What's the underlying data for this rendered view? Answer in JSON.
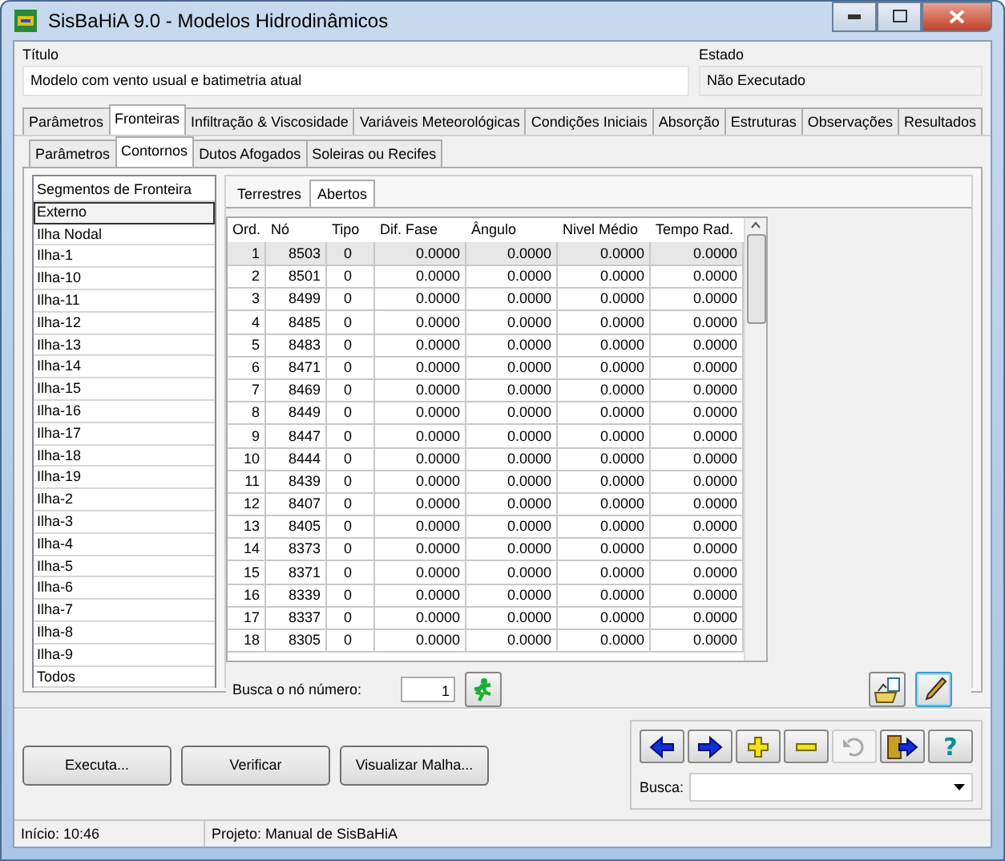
{
  "window": {
    "title": "SisBaHiA 9.0 - Modelos Hidrodinâmicos"
  },
  "titulo": {
    "label": "Título",
    "value": "Modelo com vento usual e batimetria atual"
  },
  "estado": {
    "label": "Estado",
    "value": "Não Executado"
  },
  "tabs": [
    {
      "label": "Parâmetros",
      "selected": false
    },
    {
      "label": "Fronteiras",
      "selected": true
    },
    {
      "label": "Infiltração & Viscosidade",
      "selected": false
    },
    {
      "label": "Variáveis Meteorológicas",
      "selected": false
    },
    {
      "label": "Condições Iniciais",
      "selected": false
    },
    {
      "label": "Absorção",
      "selected": false
    },
    {
      "label": "Estruturas",
      "selected": false
    },
    {
      "label": "Observações",
      "selected": false
    },
    {
      "label": "Resultados",
      "selected": false
    }
  ],
  "subtabs": [
    {
      "label": "Parâmetros",
      "selected": false
    },
    {
      "label": "Contornos",
      "selected": true
    },
    {
      "label": "Dutos Afogados",
      "selected": false
    },
    {
      "label": "Soleiras ou Recifes",
      "selected": false
    }
  ],
  "segments": {
    "header": "Segmentos de Fronteira",
    "items": [
      {
        "label": "Externo",
        "selected": true
      },
      {
        "label": "Ilha Nodal",
        "selected": false
      },
      {
        "label": "Ilha-1",
        "selected": false
      },
      {
        "label": "Ilha-10",
        "selected": false
      },
      {
        "label": "Ilha-11",
        "selected": false
      },
      {
        "label": "Ilha-12",
        "selected": false
      },
      {
        "label": "Ilha-13",
        "selected": false
      },
      {
        "label": "Ilha-14",
        "selected": false
      },
      {
        "label": "Ilha-15",
        "selected": false
      },
      {
        "label": "Ilha-16",
        "selected": false
      },
      {
        "label": "Ilha-17",
        "selected": false
      },
      {
        "label": "Ilha-18",
        "selected": false
      },
      {
        "label": "Ilha-19",
        "selected": false
      },
      {
        "label": "Ilha-2",
        "selected": false
      },
      {
        "label": "Ilha-3",
        "selected": false
      },
      {
        "label": "Ilha-4",
        "selected": false
      },
      {
        "label": "Ilha-5",
        "selected": false
      },
      {
        "label": "Ilha-6",
        "selected": false
      },
      {
        "label": "Ilha-7",
        "selected": false
      },
      {
        "label": "Ilha-8",
        "selected": false
      },
      {
        "label": "Ilha-9",
        "selected": false
      },
      {
        "label": "Todos",
        "selected": false
      }
    ]
  },
  "inner_tabs": [
    {
      "label": "Terrestres",
      "selected": false
    },
    {
      "label": "Abertos",
      "selected": true
    }
  ],
  "table": {
    "columns": [
      "Ord.",
      "Nó",
      "Tipo",
      "Dif. Fase",
      "Ângulo",
      "Nivel Médio",
      "Tempo Rad."
    ],
    "rows": [
      {
        "cells": [
          "1",
          "8503",
          "0",
          "0.0000",
          "0.0000",
          "0.0000",
          "0.0000"
        ],
        "selected": true
      },
      {
        "cells": [
          "2",
          "8501",
          "0",
          "0.0000",
          "0.0000",
          "0.0000",
          "0.0000"
        ],
        "selected": false
      },
      {
        "cells": [
          "3",
          "8499",
          "0",
          "0.0000",
          "0.0000",
          "0.0000",
          "0.0000"
        ],
        "selected": false
      },
      {
        "cells": [
          "4",
          "8485",
          "0",
          "0.0000",
          "0.0000",
          "0.0000",
          "0.0000"
        ],
        "selected": false
      },
      {
        "cells": [
          "5",
          "8483",
          "0",
          "0.0000",
          "0.0000",
          "0.0000",
          "0.0000"
        ],
        "selected": false
      },
      {
        "cells": [
          "6",
          "8471",
          "0",
          "0.0000",
          "0.0000",
          "0.0000",
          "0.0000"
        ],
        "selected": false
      },
      {
        "cells": [
          "7",
          "8469",
          "0",
          "0.0000",
          "0.0000",
          "0.0000",
          "0.0000"
        ],
        "selected": false
      },
      {
        "cells": [
          "8",
          "8449",
          "0",
          "0.0000",
          "0.0000",
          "0.0000",
          "0.0000"
        ],
        "selected": false
      },
      {
        "cells": [
          "9",
          "8447",
          "0",
          "0.0000",
          "0.0000",
          "0.0000",
          "0.0000"
        ],
        "selected": false
      },
      {
        "cells": [
          "10",
          "8444",
          "0",
          "0.0000",
          "0.0000",
          "0.0000",
          "0.0000"
        ],
        "selected": false
      },
      {
        "cells": [
          "11",
          "8439",
          "0",
          "0.0000",
          "0.0000",
          "0.0000",
          "0.0000"
        ],
        "selected": false
      },
      {
        "cells": [
          "12",
          "8407",
          "0",
          "0.0000",
          "0.0000",
          "0.0000",
          "0.0000"
        ],
        "selected": false
      },
      {
        "cells": [
          "13",
          "8405",
          "0",
          "0.0000",
          "0.0000",
          "0.0000",
          "0.0000"
        ],
        "selected": false
      },
      {
        "cells": [
          "14",
          "8373",
          "0",
          "0.0000",
          "0.0000",
          "0.0000",
          "0.0000"
        ],
        "selected": false
      },
      {
        "cells": [
          "15",
          "8371",
          "0",
          "0.0000",
          "0.0000",
          "0.0000",
          "0.0000"
        ],
        "selected": false
      },
      {
        "cells": [
          "16",
          "8339",
          "0",
          "0.0000",
          "0.0000",
          "0.0000",
          "0.0000"
        ],
        "selected": false
      },
      {
        "cells": [
          "17",
          "8337",
          "0",
          "0.0000",
          "0.0000",
          "0.0000",
          "0.0000"
        ],
        "selected": false
      },
      {
        "cells": [
          "18",
          "8305",
          "0",
          "0.0000",
          "0.0000",
          "0.0000",
          "0.0000"
        ],
        "selected": false
      }
    ]
  },
  "node_search": {
    "label": "Busca o nó número:",
    "value": "1"
  },
  "buttons": [
    "Executa...",
    "Verificar",
    "Visualizar Malha..."
  ],
  "nav_buttons": [
    {
      "kind": "back",
      "disabled": false
    },
    {
      "kind": "forward",
      "disabled": false
    },
    {
      "kind": "add",
      "disabled": false
    },
    {
      "kind": "remove",
      "disabled": false
    },
    {
      "kind": "undo",
      "disabled": true
    },
    {
      "kind": "exit",
      "disabled": false
    },
    {
      "kind": "help",
      "disabled": false,
      "label": "?"
    }
  ],
  "busca": {
    "label": "Busca:"
  },
  "status_bar": [
    "Início: 10:46",
    "Projeto: Manual de SisBaHiA"
  ]
}
